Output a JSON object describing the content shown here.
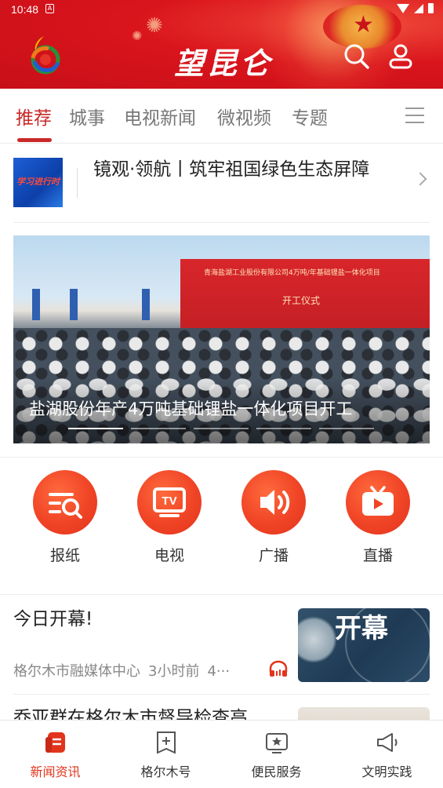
{
  "status_bar": {
    "time": "10:48",
    "sim_label": "A"
  },
  "header": {
    "app_title": "望昆仑"
  },
  "tabs": [
    {
      "label": "推荐",
      "active": true
    },
    {
      "label": "城事",
      "active": false
    },
    {
      "label": "电视新闻",
      "active": false
    },
    {
      "label": "微视频",
      "active": false
    },
    {
      "label": "专题",
      "active": false
    }
  ],
  "feature": {
    "thumb_text": "学习进行时",
    "title": "镜观·领航丨筑牢祖国绿色生态屏障"
  },
  "banner": {
    "caption": "盐湖股份年产4万吨基础锂盐一体化项目开工",
    "stage_text": "青海盐湖工业股份有限公司4万吨/年基础锂盐一体化项目",
    "stage_sub": "开工仪式",
    "slide_count": 5,
    "active_slide": 1
  },
  "quick_entries": [
    {
      "label": "报纸",
      "icon": "newspaper-search-icon"
    },
    {
      "label": "电视",
      "icon": "tv-icon"
    },
    {
      "label": "广播",
      "icon": "speaker-icon"
    },
    {
      "label": "直播",
      "icon": "live-play-icon"
    }
  ],
  "news": [
    {
      "title": "今日开幕!",
      "source": "格尔木市融媒体中心",
      "time": "3小时前",
      "extra": "4···",
      "has_audio": true,
      "thumb_text": "开幕"
    },
    {
      "title": "乔亚群在格尔木市督导检查高"
    }
  ],
  "bottom_nav": [
    {
      "label": "新闻资讯",
      "active": true,
      "icon": "news-icon"
    },
    {
      "label": "格尔木号",
      "active": false,
      "icon": "add-square-icon"
    },
    {
      "label": "便民服务",
      "active": false,
      "icon": "star-tv-icon"
    },
    {
      "label": "文明实践",
      "active": false,
      "icon": "megaphone-icon"
    }
  ],
  "colors": {
    "brand_red": "#d9141c",
    "accent": "#c92a2a",
    "quick_orange": "#f04426",
    "nav_active": "#e2341c"
  }
}
